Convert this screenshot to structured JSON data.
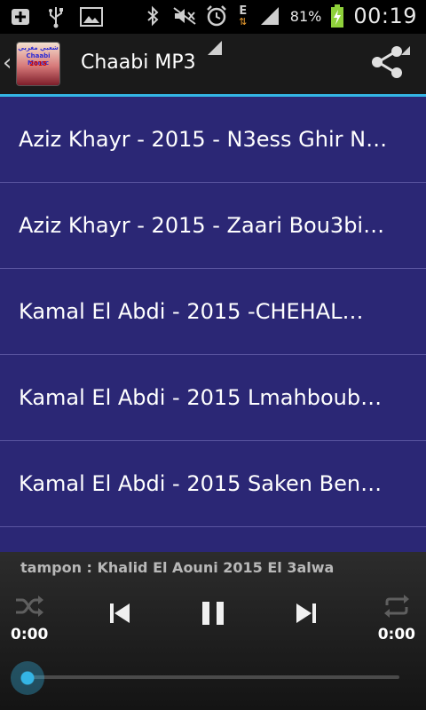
{
  "status_bar": {
    "icons": [
      "add-box-icon",
      "usb-icon",
      "image-icon",
      "bluetooth-icon",
      "mute-icon",
      "alarm-icon",
      "data-e-icon",
      "signal-icon",
      "battery-charging-icon"
    ],
    "data_type": "E",
    "battery_percent": "81%",
    "time": "00:19"
  },
  "action_bar": {
    "title": "Chaabi MP3",
    "app_icon_text": [
      "شعبي مغربي",
      "Chaabi Maroc",
      "2015"
    ],
    "accent_color": "#34b5e5"
  },
  "songs": [
    "Aziz Khayr - 2015 - N3ess Ghir N…",
    "Aziz Khayr - 2015 - Zaari Bou3bi…",
    "Kamal El Abdi - 2015 -CHEHAL…",
    "Kamal El Abdi - 2015 Lmahboub…",
    "Kamal El Abdi - 2015 Saken Ben…"
  ],
  "player": {
    "now_playing": "tampon : Khalid El Aouni 2015 El 3alwa",
    "elapsed": "0:00",
    "duration": "0:00",
    "progress_fraction": 0,
    "icons": [
      "shuffle-icon",
      "previous-icon",
      "pause-icon",
      "next-icon",
      "repeat-icon"
    ]
  },
  "colors": {
    "list_bg": "#2b2775",
    "divider": "#5a55a0",
    "player_bg": "#1e1e1e"
  }
}
